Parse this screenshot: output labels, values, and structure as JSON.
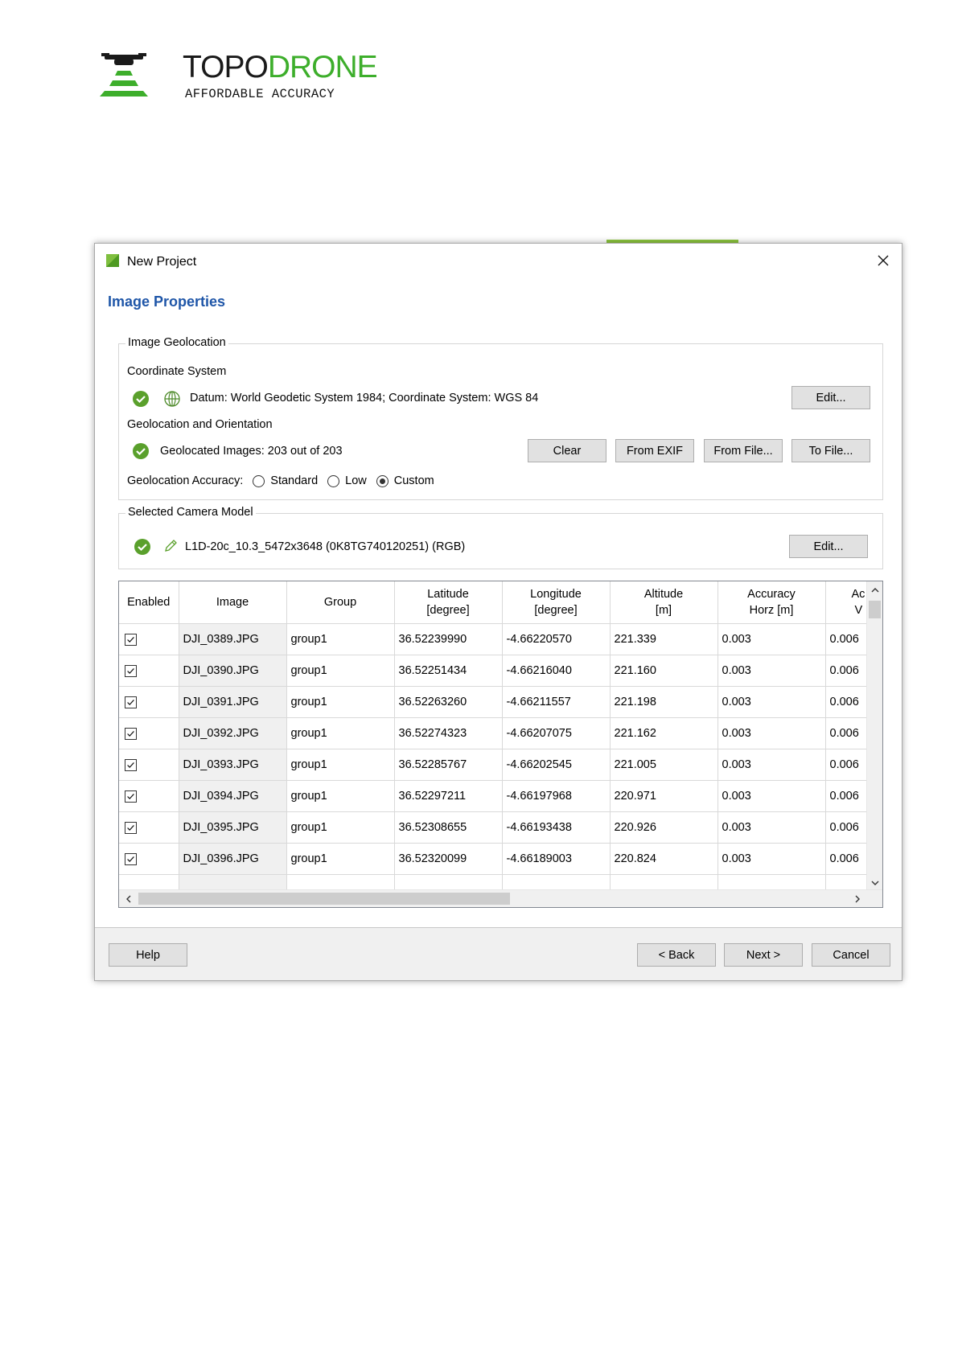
{
  "logo": {
    "word_topo": "TOPO",
    "word_drone": "DRONE",
    "tagline": "AFFORDABLE ACCURACY",
    "colors": {
      "green": "#3dae2b",
      "dark": "#1a1a1a"
    }
  },
  "window": {
    "title": "New Project",
    "page_heading": "Image Properties"
  },
  "geolocation": {
    "group_title": "Image Geolocation",
    "coord_label": "Coordinate System",
    "datum_text": "Datum: World Geodetic System 1984; Coordinate System: WGS 84",
    "edit_label": "Edit...",
    "orientation_label": "Geolocation and Orientation",
    "geolocated_text": "Geolocated Images: 203 out of 203",
    "clear_label": "Clear",
    "from_exif_label": "From EXIF",
    "from_file_label": "From File...",
    "to_file_label": "To File...",
    "accuracy_label": "Geolocation Accuracy:",
    "accuracy_options": [
      "Standard",
      "Low",
      "Custom"
    ],
    "accuracy_selected": "Custom"
  },
  "camera": {
    "group_title": "Selected Camera Model",
    "model_text": "L1D-20c_10.3_5472x3648 (0K8TG740120251) (RGB)",
    "edit_label": "Edit..."
  },
  "table": {
    "headers": {
      "enabled": "Enabled",
      "image": "Image",
      "group": "Group",
      "lat_1": "Latitude",
      "lat_2": "[degree]",
      "lon_1": "Longitude",
      "lon_2": "[degree]",
      "alt_1": "Altitude",
      "alt_2": "[m]",
      "acch_1": "Accuracy",
      "acch_2": "Horz [m]",
      "accv_1": "Ac",
      "accv_2": "V"
    },
    "rows": [
      {
        "image": "DJI_0389.JPG",
        "group": "group1",
        "lat": "36.52239990",
        "lon": "-4.66220570",
        "alt": "221.339",
        "acc_h": "0.003",
        "acc_v": "0.006"
      },
      {
        "image": "DJI_0390.JPG",
        "group": "group1",
        "lat": "36.52251434",
        "lon": "-4.66216040",
        "alt": "221.160",
        "acc_h": "0.003",
        "acc_v": "0.006"
      },
      {
        "image": "DJI_0391.JPG",
        "group": "group1",
        "lat": "36.52263260",
        "lon": "-4.66211557",
        "alt": "221.198",
        "acc_h": "0.003",
        "acc_v": "0.006"
      },
      {
        "image": "DJI_0392.JPG",
        "group": "group1",
        "lat": "36.52274323",
        "lon": "-4.66207075",
        "alt": "221.162",
        "acc_h": "0.003",
        "acc_v": "0.006"
      },
      {
        "image": "DJI_0393.JPG",
        "group": "group1",
        "lat": "36.52285767",
        "lon": "-4.66202545",
        "alt": "221.005",
        "acc_h": "0.003",
        "acc_v": "0.006"
      },
      {
        "image": "DJI_0394.JPG",
        "group": "group1",
        "lat": "36.52297211",
        "lon": "-4.66197968",
        "alt": "220.971",
        "acc_h": "0.003",
        "acc_v": "0.006"
      },
      {
        "image": "DJI_0395.JPG",
        "group": "group1",
        "lat": "36.52308655",
        "lon": "-4.66193438",
        "alt": "220.926",
        "acc_h": "0.003",
        "acc_v": "0.006"
      },
      {
        "image": "DJI_0396.JPG",
        "group": "group1",
        "lat": "36.52320099",
        "lon": "-4.66189003",
        "alt": "220.824",
        "acc_h": "0.003",
        "acc_v": "0.006"
      }
    ]
  },
  "footer": {
    "help_label": "Help",
    "back_label": "< Back",
    "next_label": "Next >",
    "cancel_label": "Cancel"
  },
  "icons": {
    "status_ok": "check-circle-icon",
    "globe": "globe-icon",
    "pencil": "pencil-icon"
  },
  "colors": {
    "heading_blue": "#1f56a8",
    "ok_green": "#5aa02c",
    "button_face": "#e1e1e1"
  }
}
